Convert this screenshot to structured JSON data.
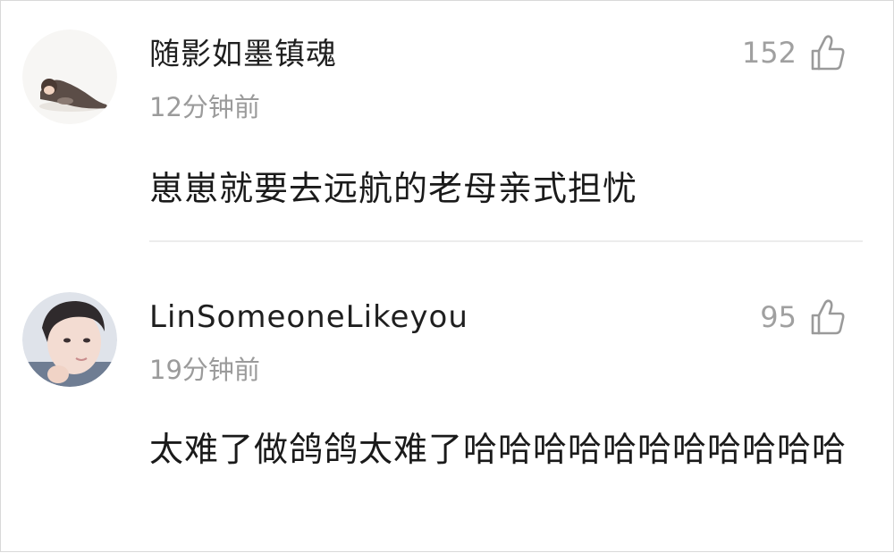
{
  "comments": [
    {
      "username": "随影如墨镇魂",
      "time": "12分钟前",
      "likes": "152",
      "text": "崽崽就要去远航的老母亲式担忧",
      "avatar_icon": "cartoon-avatar-icon"
    },
    {
      "username": "LinSomeoneLikeyou",
      "time": "19分钟前",
      "likes": "95",
      "text": "太难了做鸽鸽太难了哈哈哈哈哈哈哈哈哈哈哈",
      "avatar_icon": "photo-avatar-icon"
    }
  ],
  "icons": {
    "like": "thumbs-up-icon"
  },
  "colors": {
    "text": "#1a1a1a",
    "muted": "#9b9b9b",
    "divider": "#ececec"
  }
}
